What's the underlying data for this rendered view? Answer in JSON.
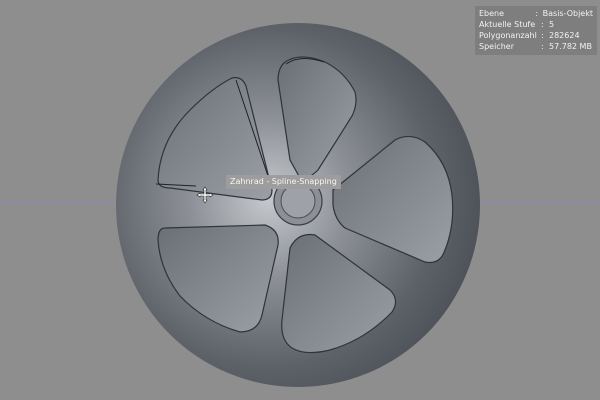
{
  "hud": {
    "rows": [
      {
        "label": "Ebene",
        "sep": ":",
        "value": "Basis-Objekt"
      },
      {
        "label": "Aktuelle Stufe",
        "sep": ":",
        "value": "5"
      },
      {
        "label": "Polygonanzahl",
        "sep": ":",
        "value": "282624"
      },
      {
        "label": "Speicher",
        "sep": ":",
        "value": "57.782 MB"
      }
    ]
  },
  "tooltip": {
    "text": "Zahnrad - Spline-Snapping"
  },
  "colors": {
    "background": "#8e8e8e",
    "object": "#5b6068",
    "object_highlight": "#bfc3c8",
    "axis_x": "#8080b0",
    "hud_bg": "#787878"
  },
  "icons": {
    "cursor": "snap-move-cursor-icon"
  }
}
